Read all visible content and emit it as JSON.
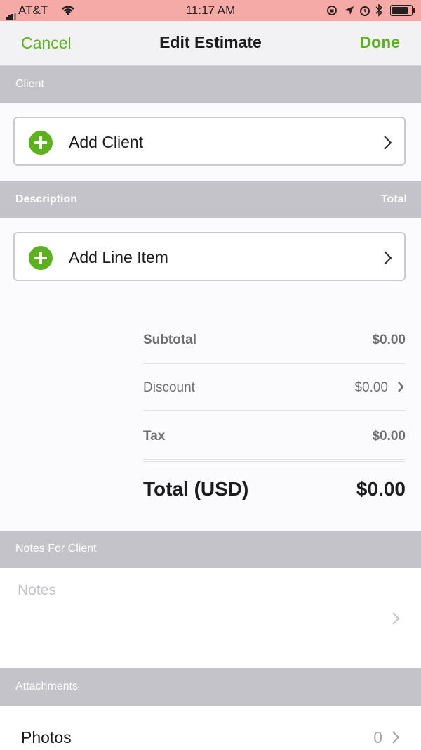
{
  "status_bar": {
    "carrier": "AT&T",
    "time": "11:17 AM"
  },
  "nav": {
    "cancel": "Cancel",
    "title": "Edit Estimate",
    "done": "Done"
  },
  "client_section": {
    "header": "Client",
    "add_label": "Add Client"
  },
  "items_section": {
    "header_left": "Description",
    "header_right": "Total",
    "add_label": "Add Line Item"
  },
  "totals": {
    "subtotal_label": "Subtotal",
    "subtotal_value": "$0.00",
    "discount_label": "Discount",
    "discount_value": "$0.00",
    "tax_label": "Tax",
    "tax_value": "$0.00",
    "total_label": "Total (USD)",
    "total_value": "$0.00"
  },
  "notes_section": {
    "header": "Notes For Client",
    "placeholder": "Notes"
  },
  "attachments_section": {
    "header": "Attachments",
    "photos_label": "Photos",
    "photos_count": "0"
  },
  "colors": {
    "accent": "#5bb21d",
    "section_bg": "#c4c3ca",
    "status_bar": "#f5aaa7"
  },
  "icons": [
    "wifi-icon",
    "signal-icon",
    "battery-icon",
    "bluetooth-icon",
    "alarm-icon",
    "location-icon",
    "lock-rotation-icon",
    "plus-circle-icon",
    "chevron-right-icon"
  ]
}
